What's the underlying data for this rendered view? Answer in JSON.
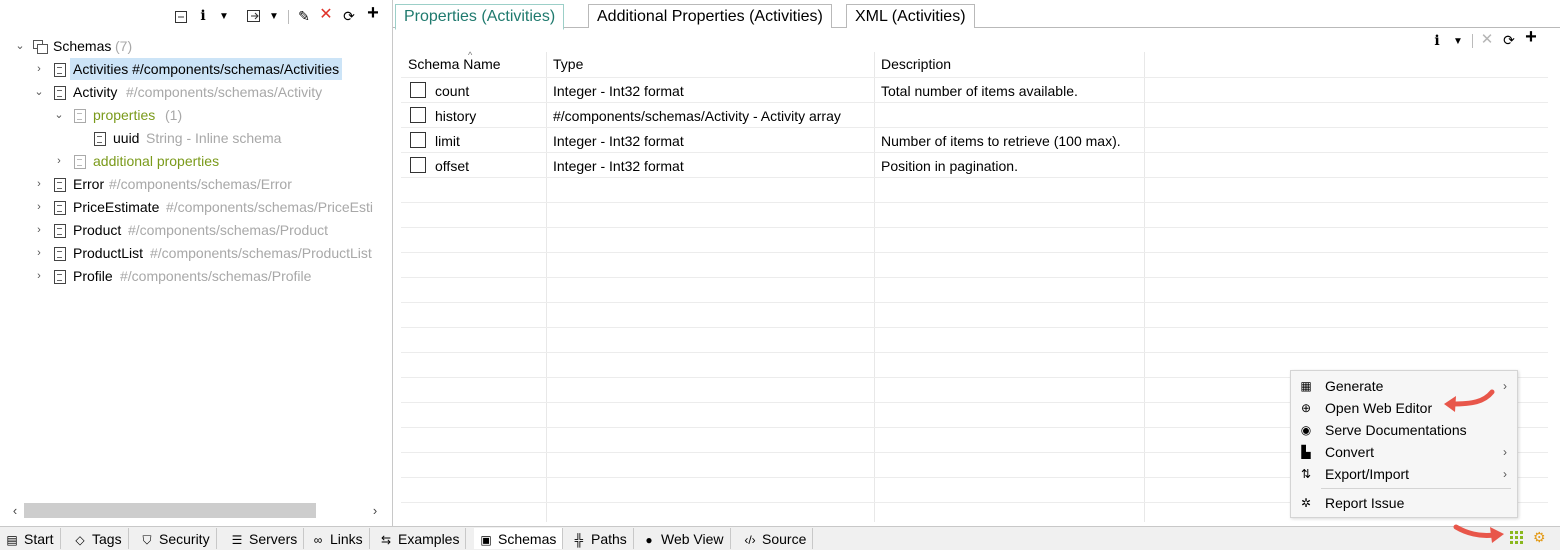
{
  "left_toolbar": {
    "icons": [
      "collapse-all-icon",
      "info-icon",
      "dropdown-icon",
      "export-icon",
      "dropdown-icon",
      "edit-icon",
      "delete-icon",
      "refresh-icon",
      "add-icon"
    ]
  },
  "tree": {
    "root": {
      "label": "Schemas",
      "count": "(7)"
    },
    "items": [
      {
        "name": "Activities",
        "path": "#/components/schemas/Activities"
      },
      {
        "name": "Activity",
        "path": "#/components/schemas/Activity"
      },
      {
        "name": "properties",
        "count": "(1)"
      },
      {
        "name": "uuid",
        "path": "String - Inline schema"
      },
      {
        "name": "additional properties"
      },
      {
        "name": "Error",
        "path": "#/components/schemas/Error"
      },
      {
        "name": "PriceEstimate",
        "path": "#/components/schemas/PriceEsti"
      },
      {
        "name": "Product",
        "path": "#/components/schemas/Product"
      },
      {
        "name": "ProductList",
        "path": "#/components/schemas/ProductList"
      },
      {
        "name": "Profile",
        "path": "#/components/schemas/Profile"
      }
    ]
  },
  "tabs": [
    {
      "label": "Properties (Activities)"
    },
    {
      "label": "Additional Properties (Activities)"
    },
    {
      "label": "XML (Activities)"
    }
  ],
  "grid": {
    "headers": [
      "Schema Name",
      "Type",
      "Description"
    ],
    "rows": [
      {
        "name": "count",
        "type": "Integer - Int32 format",
        "description": "Total number of items available."
      },
      {
        "name": "history",
        "type": "#/components/schemas/Activity - Activity array",
        "description": ""
      },
      {
        "name": "limit",
        "type": "Integer - Int32 format",
        "description": "Number of items to retrieve (100 max)."
      },
      {
        "name": "offset",
        "type": "Integer - Int32 format",
        "description": "Position in pagination."
      }
    ]
  },
  "context_menu": {
    "items": [
      {
        "label": "Generate",
        "icon": "generate-icon",
        "submenu": true
      },
      {
        "label": "Open Web Editor",
        "icon": "globe-icon",
        "submenu": false
      },
      {
        "label": "Serve Documentations",
        "icon": "serve-icon",
        "submenu": false
      },
      {
        "label": "Convert",
        "icon": "convert-icon",
        "submenu": true
      },
      {
        "label": "Export/Import",
        "icon": "export-import-icon",
        "submenu": true
      },
      {
        "label": "Report Issue",
        "icon": "bug-icon",
        "submenu": false
      }
    ]
  },
  "bottom_tabs": [
    {
      "label": "Start",
      "icon": "start-icon"
    },
    {
      "label": "Tags",
      "icon": "tag-icon"
    },
    {
      "label": "Security",
      "icon": "shield-icon"
    },
    {
      "label": "Servers",
      "icon": "server-icon"
    },
    {
      "label": "Links",
      "icon": "link-icon"
    },
    {
      "label": "Examples",
      "icon": "examples-icon"
    },
    {
      "label": "Schemas",
      "icon": "schemas-icon"
    },
    {
      "label": "Paths",
      "icon": "paths-icon"
    },
    {
      "label": "Web View",
      "icon": "web-icon"
    },
    {
      "label": "Source",
      "icon": "source-icon"
    }
  ],
  "colors": {
    "accent": "#1f7a6e",
    "selection": "#cce4f7",
    "arrow": "#e8564a",
    "green": "#7a9a1a"
  }
}
